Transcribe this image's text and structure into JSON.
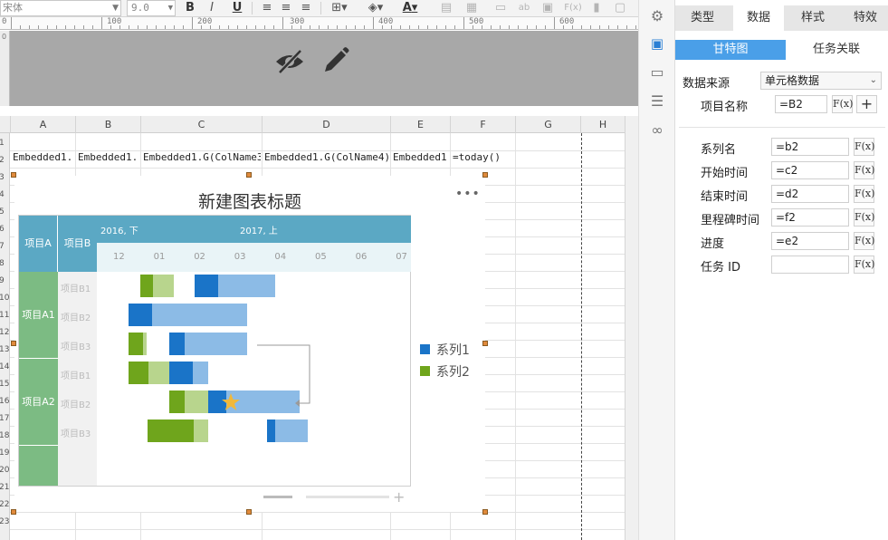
{
  "toolbar": {
    "font_name": "宋体",
    "font_size": "9.0",
    "bold": "B",
    "italic": "I",
    "underline": "U",
    "text_color_icon": "A"
  },
  "ruler": {
    "labels": [
      "0",
      "100",
      "200",
      "300",
      "400",
      "500",
      "600"
    ],
    "vlabel": "0"
  },
  "columns": [
    "A",
    "B",
    "C",
    "D",
    "E",
    "F",
    "G",
    "H"
  ],
  "row_numbers": [
    "1",
    "2",
    "3",
    "4",
    "5",
    "6",
    "7",
    "8",
    "9",
    "10",
    "11",
    "12",
    "13",
    "14",
    "15",
    "16",
    "17",
    "18",
    "19",
    "20",
    "21",
    "22",
    "23"
  ],
  "cells": {
    "A2": "Embedded1.",
    "B2": "Embedded1.",
    "C2": "Embedded1.G(ColName3)",
    "D2": "Embedded1.G(ColName4)",
    "E2": "Embedded1.",
    "F2": "=today()"
  },
  "chart": {
    "title": "新建图表标题",
    "more": "•••",
    "header": {
      "col_a": "项目A",
      "col_b": "项目B",
      "period_1": "2016, 下",
      "period_2": "2017, 上",
      "months": [
        "12",
        "01",
        "02",
        "03",
        "04",
        "05",
        "06",
        "07"
      ]
    },
    "groups": [
      "项目A1",
      "项目A2"
    ],
    "sub_items": [
      "项目B1",
      "项目B2",
      "项目B3",
      "项目B1",
      "项目B2",
      "项目B3"
    ],
    "legend": [
      {
        "name": "系列1",
        "color": "#1a74c8"
      },
      {
        "name": "系列2",
        "color": "#6fa51c"
      }
    ]
  },
  "chart_data": {
    "type": "bar",
    "subtype": "gantt",
    "title": "新建图表标题",
    "x_periods": [
      "2016, 下",
      "2017, 上"
    ],
    "x_ticks": [
      "12",
      "01",
      "02",
      "03",
      "04",
      "05",
      "06",
      "07"
    ],
    "categories": [
      "项目A1 / 项目B1",
      "项目A1 / 项目B2",
      "项目A1 / 项目B3",
      "项目A2 / 项目B1",
      "项目A2 / 项目B2",
      "项目A2 / 项目B3"
    ],
    "tasks": [
      {
        "row": 0,
        "series": "系列2",
        "start": 0.77,
        "end": 1.6,
        "progress": 0.38
      },
      {
        "row": 0,
        "series": "系列1",
        "start": 2.1,
        "end": 4.1,
        "progress": 0.3
      },
      {
        "row": 1,
        "series": "系列1",
        "start": 0.47,
        "end": 3.4,
        "progress": 0.2
      },
      {
        "row": 2,
        "series": "系列2",
        "start": 0.47,
        "end": 0.92,
        "progress": 0.8
      },
      {
        "row": 2,
        "series": "系列1",
        "start": 1.48,
        "end": 3.4,
        "progress": 0.2
      },
      {
        "row": 3,
        "series": "系列2",
        "start": 0.47,
        "end": 1.48,
        "progress": 0.5
      },
      {
        "row": 3,
        "series": "系列1",
        "start": 1.48,
        "end": 2.45,
        "progress": 0.6
      },
      {
        "row": 4,
        "series": "系列2",
        "start": 1.48,
        "end": 2.45,
        "progress": 0.4
      },
      {
        "row": 4,
        "series": "系列1",
        "start": 2.45,
        "end": 4.7,
        "progress": 0.2
      },
      {
        "row": 5,
        "series": "系列2",
        "start": 0.95,
        "end": 2.45,
        "progress": 0.75
      },
      {
        "row": 5,
        "series": "系列1",
        "start": 3.9,
        "end": 4.9,
        "progress": 0.2
      }
    ],
    "milestone": {
      "row": 4,
      "x": 3.0
    },
    "legend": [
      "系列1",
      "系列2"
    ],
    "legend_position": "right"
  },
  "panel": {
    "tabs": [
      "类型",
      "数据",
      "样式",
      "特效"
    ],
    "active_tab": "数据",
    "subtabs": [
      "甘特图",
      "任务关联"
    ],
    "data_source_label": "数据来源",
    "data_source_value": "单元格数据",
    "project_name_label": "项目名称",
    "project_name_value": "=B2",
    "fx_label": "F(x)",
    "fields": [
      {
        "label": "系列名",
        "value": "=b2"
      },
      {
        "label": "开始时间",
        "value": "=c2"
      },
      {
        "label": "结束时间",
        "value": "=d2"
      },
      {
        "label": "里程碑时间",
        "value": "=f2"
      },
      {
        "label": "进度",
        "value": "=e2"
      },
      {
        "label": "任务 ID",
        "value": ""
      }
    ]
  },
  "colors": {
    "series1": "#1a74c8",
    "series1_light": "#8cbbe6",
    "series2": "#6fa51c",
    "series2_light": "#b8d58d",
    "header_blue": "#5ba8c4",
    "group_green": "#7cbb83",
    "accent": "#4a9fe8"
  }
}
